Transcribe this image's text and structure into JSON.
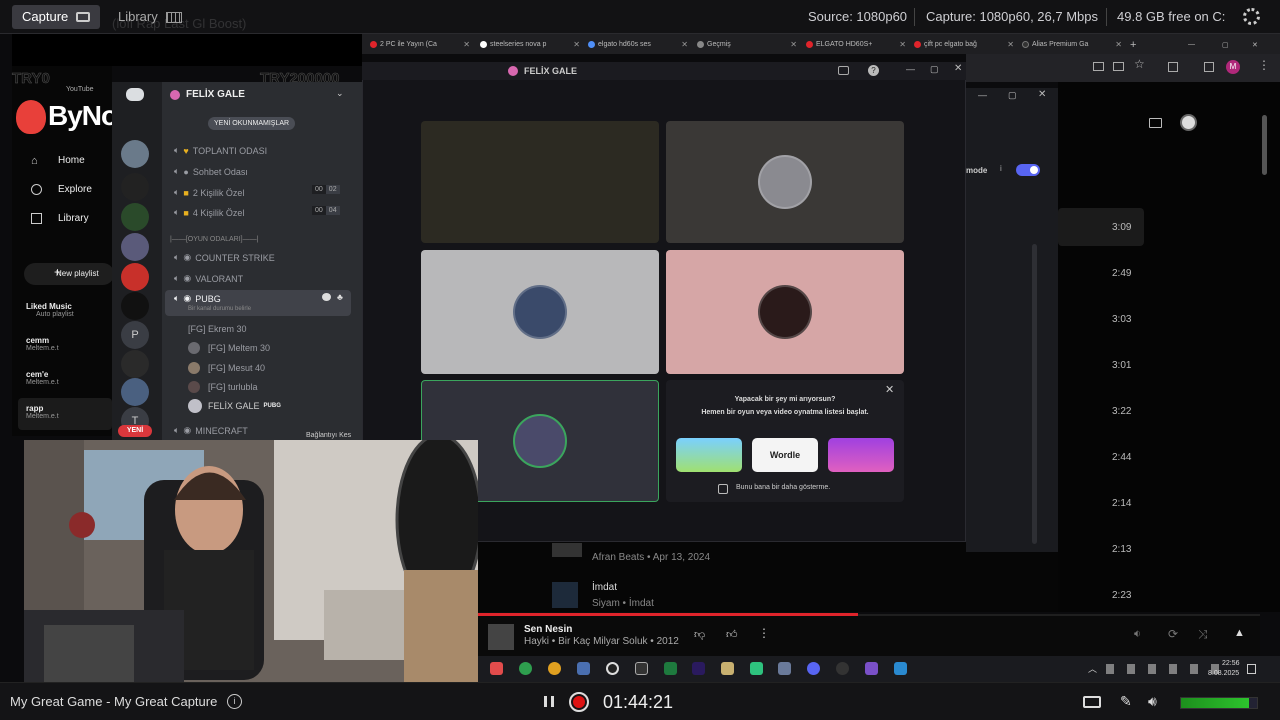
{
  "capture_app": {
    "tabs": [
      "Capture",
      "Library"
    ],
    "source": "Source: 1080p60",
    "capture": "Capture: 1080p60, 26,7 Mbps",
    "free": "49.8 GB free on C:",
    "bottom_title": "My Great Game - My Great Capture",
    "timer": "01:44:21"
  },
  "overlay": {
    "left_try": "TRY0",
    "right_try": "TRY200000",
    "faded": "(lofi Rap Last Gl Boost)",
    "logo": "ByNoGame"
  },
  "browser": {
    "tabs": [
      {
        "label": "2 PC ile Yayın (Ca",
        "color": "#e0242b"
      },
      {
        "label": "steelseries nova p",
        "color": "#ffffff"
      },
      {
        "label": "elgato hd60s ses",
        "color": "#4f8ff7"
      },
      {
        "label": "Geçmiş",
        "color": "#888888"
      },
      {
        "label": "ELGATO HD60S+",
        "color": "#e0242b"
      },
      {
        "label": "çift pc elgato bağ",
        "color": "#e0242b"
      },
      {
        "label": "Alias Premium Ga",
        "color": "#333333"
      }
    ],
    "profile_initial": "M"
  },
  "ytm": {
    "nav": [
      "Home",
      "Explore",
      "Library"
    ],
    "new_playlist": "New playlist",
    "mini_header": "YouTube",
    "playlists": [
      {
        "title": "Liked Music",
        "sub": "Auto playlist"
      },
      {
        "title": "cemm",
        "sub": "Meltem.e.t"
      },
      {
        "title": "cem'e",
        "sub": "Meltem.e.t"
      },
      {
        "title": "rapp",
        "sub": "Meltem.e.t"
      }
    ],
    "durations": [
      "3:09",
      "2:49",
      "3:03",
      "3:01",
      "3:22",
      "2:44",
      "2:14",
      "2:13",
      "2:23"
    ],
    "mode_label": "mode",
    "rows": [
      {
        "artist": "Afran Beats • Apr 13, 2024"
      },
      {
        "title": "İmdat",
        "artist": "Siyam • İmdat"
      }
    ],
    "now_playing": {
      "title": "Sen Nesin",
      "artist": "Hayki • Bir Kaç Milyar Soluk • 2012"
    }
  },
  "discord": {
    "server_name": "FELİX GALE",
    "unread_badge": "YENİ OKUNMAMIŞLAR",
    "channels": [
      {
        "name": "TOPLANTI ODASI"
      },
      {
        "name": "Sohbet Odası"
      },
      {
        "name": "2 Kişilik Özel",
        "count": "00",
        "cap": "02"
      },
      {
        "name": "4 Kişilik Özel",
        "count": "00",
        "cap": "04"
      }
    ],
    "category": "|——[OYUN ODALARI]——|",
    "game_channels": [
      "COUNTER STRIKE",
      "VALORANT",
      "PUBG",
      "MINECRAFT"
    ],
    "status_hint": "Bir kanal durumu belirle",
    "members": [
      "[FG] Ekrem 30",
      "[FG] Meltem 30",
      "[FG] Mesut 40",
      "[FG] turlubla",
      "FELİX GALE"
    ],
    "member_tag": "PUBG",
    "new_badge": "YENİ",
    "disconnect": "Bağlantıyı Kes",
    "server_letters": [
      "P",
      "T"
    ]
  },
  "call": {
    "title": "FELİX GALE",
    "promo_line1": "Yapacak bir şey mi arıyorsun?",
    "promo_line2": "Hemen bir oyun veya video oynatma listesi başlat.",
    "games": [
      "",
      "Wordle",
      ""
    ],
    "dont_show": "Bunu bana bir daha gösterme."
  },
  "taskbar": {
    "time": "22:56",
    "date": "8.08.2025"
  }
}
